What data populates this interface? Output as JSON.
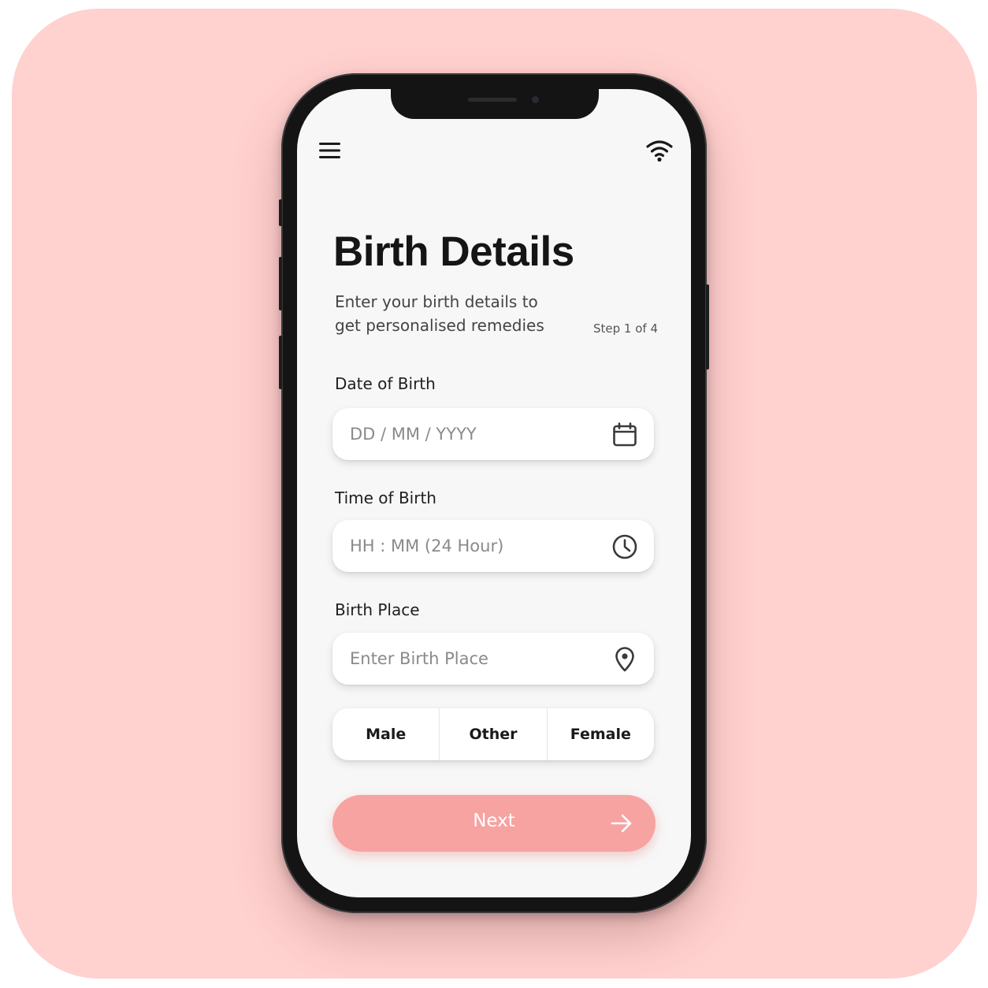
{
  "colors": {
    "background": "#ffd1cf",
    "screen": "#f7f7f7",
    "accent": "#f6a3a2",
    "text": "#151515"
  },
  "header": {
    "menu_icon": "hamburger-menu-icon",
    "status_icon": "wifi-icon"
  },
  "page": {
    "title": "Birth Details",
    "subtitle": "Enter your birth details to get personalised remedies",
    "step": "Step 1 of 4"
  },
  "fields": {
    "dob": {
      "label": "Date of Birth",
      "placeholder": "DD / MM / YYYY",
      "value": "",
      "icon": "calendar-icon"
    },
    "tob": {
      "label": "Time of Birth",
      "placeholder": "HH : MM (24 Hour)",
      "value": "",
      "icon": "clock-icon"
    },
    "place": {
      "label": "Birth Place",
      "placeholder": "Enter Birth Place",
      "value": "",
      "icon": "location-pin-icon"
    }
  },
  "gender": {
    "options": [
      "Male",
      "Other",
      "Female"
    ],
    "selected": ""
  },
  "next_button": {
    "label": "Next",
    "icon": "arrow-right-icon"
  }
}
